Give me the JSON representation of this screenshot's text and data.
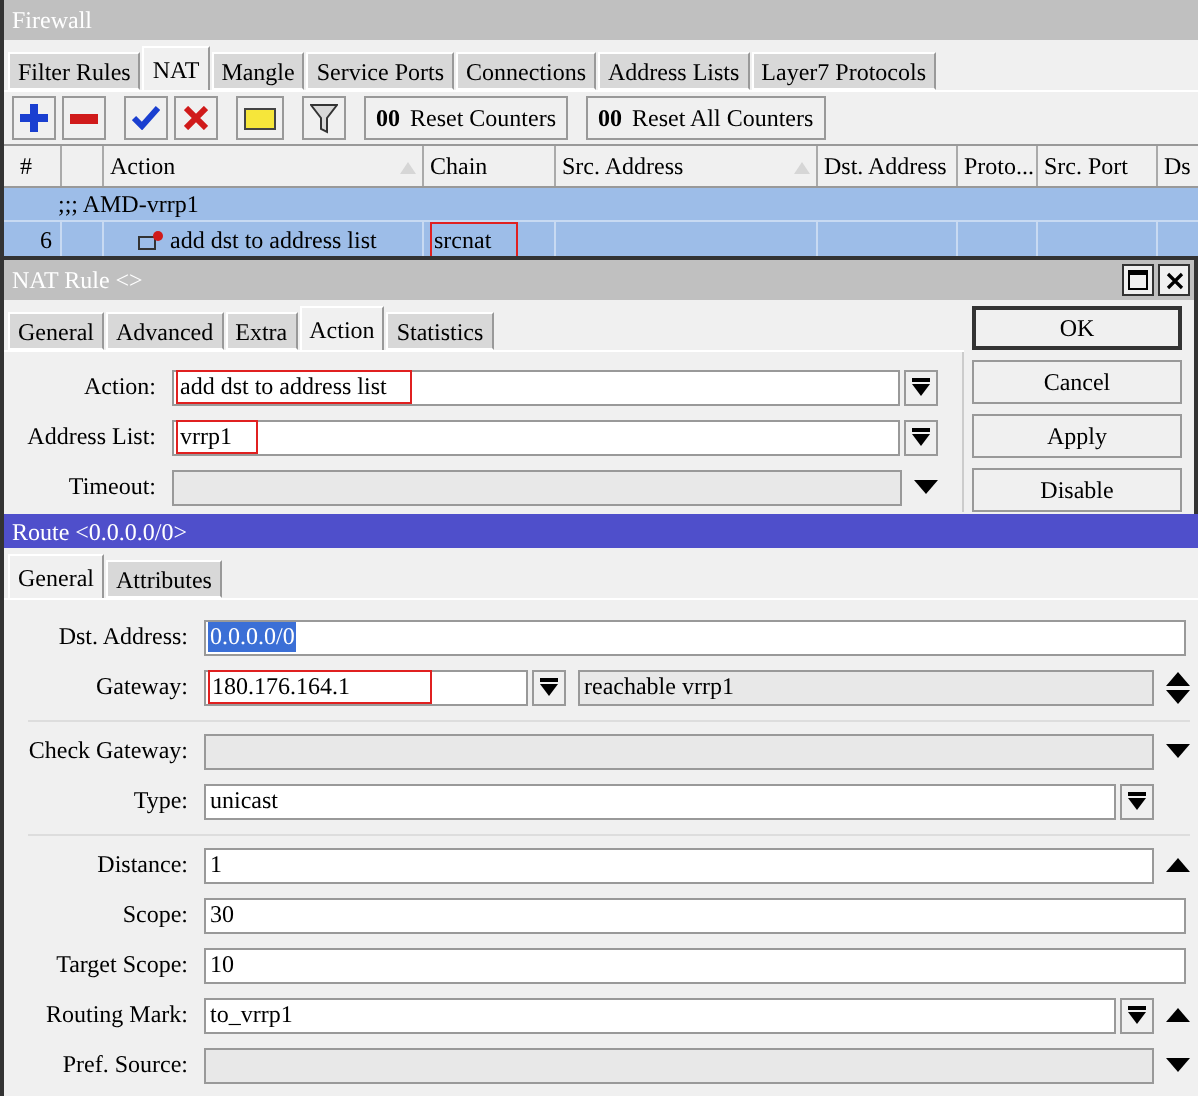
{
  "firewall": {
    "title": "Firewall",
    "tabs": [
      {
        "label": "Filter Rules",
        "selected": false
      },
      {
        "label": "NAT",
        "selected": true
      },
      {
        "label": "Mangle",
        "selected": false
      },
      {
        "label": "Service Ports",
        "selected": false
      },
      {
        "label": "Connections",
        "selected": false
      },
      {
        "label": "Address Lists",
        "selected": false
      },
      {
        "label": "Layer7 Protocols",
        "selected": false
      }
    ],
    "counter_buttons": [
      {
        "mark": "00",
        "label": "Reset Counters"
      },
      {
        "mark": "00",
        "label": "Reset All Counters"
      }
    ],
    "columns": [
      {
        "label": "#",
        "sort_mark": false
      },
      {
        "label": "Action",
        "sort_mark": true
      },
      {
        "label": "Chain",
        "sort_mark": false
      },
      {
        "label": "Src. Address",
        "sort_mark": true
      },
      {
        "label": "Dst. Address",
        "sort_mark": false
      },
      {
        "label": "Proto...",
        "sort_mark": false
      },
      {
        "label": "Src. Port",
        "sort_mark": false
      },
      {
        "label": "Ds",
        "sort_mark": false
      }
    ],
    "rows": [
      {
        "kind": "comment",
        "text": ";;; AMD-vrrp1",
        "selected": true
      },
      {
        "kind": "rule",
        "number": "6",
        "action": "add dst to address list",
        "chain": "srcnat",
        "chain_highlighted": true,
        "selected": true
      }
    ]
  },
  "nat_rule": {
    "title": "NAT Rule <>",
    "tabs": [
      {
        "label": "General",
        "selected": false
      },
      {
        "label": "Advanced",
        "selected": false
      },
      {
        "label": "Extra",
        "selected": false
      },
      {
        "label": "Action",
        "selected": true
      },
      {
        "label": "Statistics",
        "selected": false
      }
    ],
    "fields": [
      {
        "kind": "select",
        "label": "Action:",
        "value": "add dst to address list",
        "highlighted": true,
        "disabled": false
      },
      {
        "kind": "select",
        "label": "Address List:",
        "value": "vrrp1",
        "highlighted": true,
        "disabled": false
      },
      {
        "kind": "expandable",
        "label": "Timeout:",
        "disabled": true
      }
    ],
    "buttons": [
      {
        "label": "OK",
        "default": true
      },
      {
        "label": "Cancel",
        "default": false
      },
      {
        "label": "Apply",
        "default": false
      },
      {
        "label": "Disable",
        "default": false
      }
    ]
  },
  "route": {
    "title": "Route <0.0.0.0/0>",
    "tabs": [
      {
        "label": "General",
        "selected": true
      },
      {
        "label": "Attributes",
        "selected": false
      }
    ],
    "groups": [
      [
        {
          "kind": "plain",
          "label": "Dst. Address:",
          "value": "0.0.0.0/0",
          "text_selected": true,
          "disabled": false
        },
        {
          "kind": "gateway",
          "label": "Gateway:",
          "value": "180.176.164.1",
          "highlighted": true,
          "disabled": false,
          "status": "reachable vrrp1"
        }
      ],
      [
        {
          "kind": "expandable",
          "label": "Check Gateway:",
          "disabled": true
        },
        {
          "kind": "select",
          "label": "Type:",
          "value": "unicast",
          "disabled": false
        }
      ],
      [
        {
          "kind": "spin_up",
          "label": "Distance:",
          "value": "1",
          "disabled": false
        },
        {
          "kind": "plain",
          "label": "Scope:",
          "value": "30",
          "disabled": false
        },
        {
          "kind": "plain",
          "label": "Target Scope:",
          "value": "10",
          "disabled": false
        },
        {
          "kind": "select_up",
          "label": "Routing Mark:",
          "value": "to_vrrp1",
          "disabled": false
        },
        {
          "kind": "expandable",
          "label": "Pref. Source:",
          "disabled": true
        }
      ]
    ]
  }
}
